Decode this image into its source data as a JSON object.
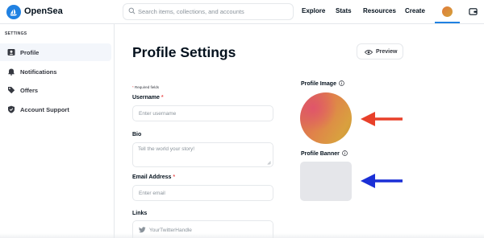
{
  "header": {
    "brand": "OpenSea",
    "logo_icon": "opensea-logo-icon",
    "search": {
      "placeholder": "Search items, collections, and accounts",
      "value": ""
    },
    "nav": [
      {
        "label": "Explore"
      },
      {
        "label": "Stats"
      },
      {
        "label": "Resources"
      },
      {
        "label": "Create"
      }
    ],
    "accent_color": "#2081e2"
  },
  "sidebar": {
    "heading": "SETTINGS",
    "items": [
      {
        "label": "Profile",
        "icon": "profile-card-icon",
        "active": true
      },
      {
        "label": "Notifications",
        "icon": "bell-icon",
        "active": false
      },
      {
        "label": "Offers",
        "icon": "tag-icon",
        "active": false
      },
      {
        "label": "Account Support",
        "icon": "shield-icon",
        "active": false
      }
    ]
  },
  "main": {
    "title": "Profile Settings",
    "preview_label": "Preview",
    "required_note": "Required fields",
    "required_marker": "*",
    "fields": {
      "username": {
        "label": "Username",
        "required": true,
        "placeholder": "Enter username",
        "value": ""
      },
      "bio": {
        "label": "Bio",
        "required": false,
        "placeholder": "Tell the world your story!",
        "value": ""
      },
      "email": {
        "label": "Email Address",
        "required": true,
        "placeholder": "Enter email",
        "value": ""
      },
      "links": {
        "label": "Links",
        "twitter_placeholder": "YourTwitterHandle",
        "value": ""
      }
    },
    "profile_image_label": "Profile Image",
    "profile_banner_label": "Profile Banner"
  },
  "annotations": {
    "red_arrow_color": "#e8402a",
    "blue_arrow_color": "#1a2fd6"
  }
}
